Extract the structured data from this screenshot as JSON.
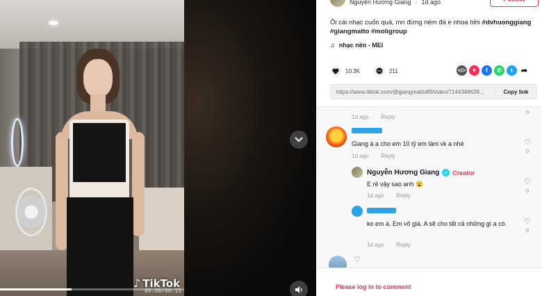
{
  "video": {
    "watermark": "TikTok",
    "time": "00:00/00:15",
    "progress": 0.39
  },
  "author": {
    "name": "Nguyễn Hương Giang",
    "age": "1d ago",
    "follow_label": "Follow"
  },
  "caption": {
    "text": "Ôi cái nhạc cuốn quá, mn đừng ném đá e nhoa hihi",
    "hashtags": [
      "#dvhuonggiang",
      "#giangmatto",
      "#moligroup"
    ]
  },
  "music": {
    "label": "nhạc nền - MEI"
  },
  "stats": {
    "likes": "10.3K",
    "comments": "211"
  },
  "share": {
    "link": "https://www.tiktok.com/@giangmatto89/video/7144348628...",
    "copy_label": "Copy link"
  },
  "comments": [
    {
      "age": "1d ago",
      "reply": "Reply",
      "likes": "0"
    },
    {
      "name": "",
      "text": "Giang à a cho em 10 tỷ em làm vk a nhé",
      "age": "1d ago",
      "reply": "Reply",
      "likes": "0"
    },
    {
      "name": "Nguyễn Hương Giang",
      "badge": "Creator",
      "text": "E rẻ vậy sao anh 😮",
      "age": "1d ago",
      "reply": "Reply",
      "likes": "0"
    },
    {
      "name": "",
      "text": "ko em à. Em vô giá. A sẽ cho tất cả những gì a có.",
      "age": "1d ago",
      "reply": "Reply",
      "likes": "0"
    }
  ],
  "login": {
    "label": "Please log in to comment"
  },
  "colors": {
    "accent": "#fe2c55",
    "tag": "#2aa3e8"
  }
}
